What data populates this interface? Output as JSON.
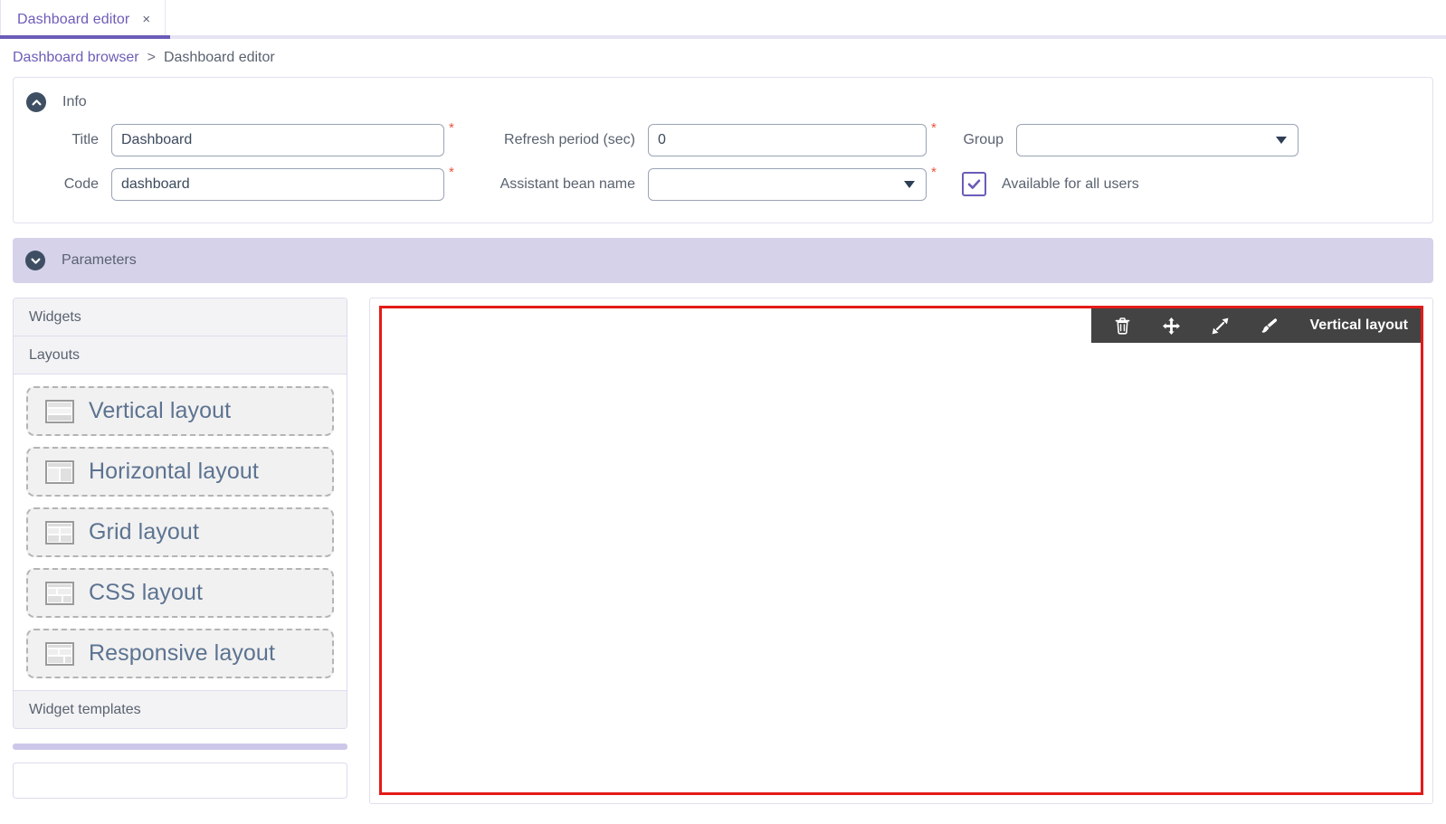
{
  "tab": {
    "label": "Dashboard editor",
    "close_label": "×"
  },
  "breadcrumb": {
    "link": "Dashboard browser",
    "separator": ">",
    "current": "Dashboard editor"
  },
  "info_panel": {
    "title": "Info",
    "toggle_icon": "chevron-up-icon",
    "fields": {
      "title_label": "Title",
      "title_value": "Dashboard",
      "title_required": "*",
      "code_label": "Code",
      "code_value": "dashboard",
      "code_required": "*",
      "refresh_label": "Refresh period (sec)",
      "refresh_value": "0",
      "refresh_required": "*",
      "bean_label": "Assistant bean name",
      "bean_value": "",
      "bean_required": "*",
      "group_label": "Group",
      "group_value": "",
      "available_label": "Available for all users",
      "available_checked": true
    }
  },
  "parameters_panel": {
    "title": "Parameters",
    "toggle_icon": "chevron-down-icon"
  },
  "sidebar": {
    "sections": [
      {
        "label": "Widgets"
      },
      {
        "label": "Layouts"
      },
      {
        "label": "Widget templates"
      }
    ],
    "layouts": [
      {
        "label": "Vertical layout",
        "icon": "vertical-layout-icon"
      },
      {
        "label": "Horizontal layout",
        "icon": "horizontal-layout-icon"
      },
      {
        "label": "Grid layout",
        "icon": "grid-layout-icon"
      },
      {
        "label": "CSS layout",
        "icon": "css-layout-icon"
      },
      {
        "label": "Responsive layout",
        "icon": "responsive-layout-icon"
      }
    ]
  },
  "canvas": {
    "selected_widget": {
      "title": "Vertical layout",
      "toolbar": [
        {
          "name": "delete-icon",
          "title": "Delete"
        },
        {
          "name": "move-icon",
          "title": "Move"
        },
        {
          "name": "resize-icon",
          "title": "Resize"
        },
        {
          "name": "style-icon",
          "title": "Style"
        }
      ]
    }
  },
  "colors": {
    "accent_purple": "#6b5cb8",
    "panel_lavender": "#d6d2ea",
    "selection_red": "#e31b18",
    "toolbar_dark": "#434343",
    "required_red": "#e8543f"
  }
}
